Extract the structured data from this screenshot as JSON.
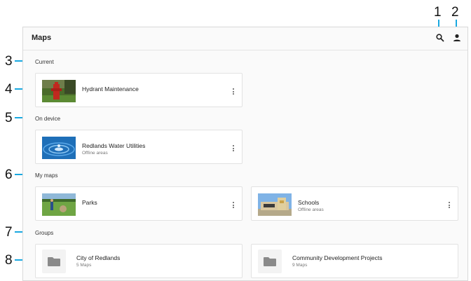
{
  "callouts": [
    "1",
    "2",
    "3",
    "4",
    "5",
    "6",
    "7",
    "8"
  ],
  "appbar": {
    "title": "Maps"
  },
  "sections": {
    "current": "Current",
    "on_device": "On device",
    "my_maps": "My maps",
    "groups": "Groups"
  },
  "current": {
    "title": "Hydrant Maintenance"
  },
  "on_device": {
    "title": "Redlands Water Utilities",
    "subtitle": "Offline areas"
  },
  "my_maps": [
    {
      "title": "Parks",
      "subtitle": ""
    },
    {
      "title": "Schools",
      "subtitle": "Offline areas"
    }
  ],
  "groups": [
    {
      "title": "City of Redlands",
      "subtitle": "5 Maps"
    },
    {
      "title": "Community Development Projects",
      "subtitle": "9 Maps"
    }
  ],
  "icons": {
    "search": "search-icon",
    "account": "account-icon",
    "more": "more-vertical-icon",
    "folder": "folder-icon"
  },
  "colors": {
    "callout": "#19a8e0"
  }
}
